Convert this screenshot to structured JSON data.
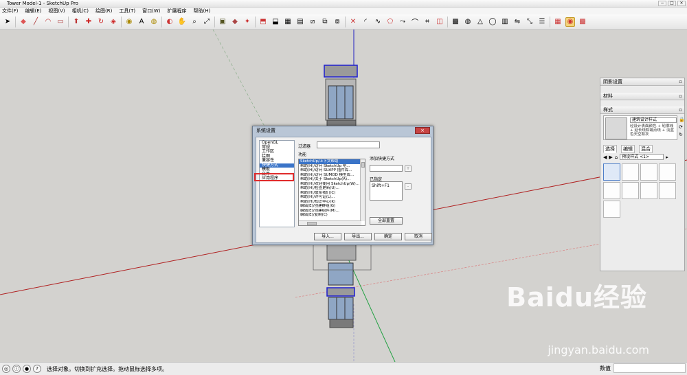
{
  "window": {
    "title": "Tower Model-1 - SketchUp Pro",
    "min": "−",
    "max": "□",
    "close": "×"
  },
  "menu": [
    "文件(F)",
    "编辑(E)",
    "视图(V)",
    "相机(C)",
    "绘图(R)",
    "工具(T)",
    "窗口(W)",
    "扩展程序",
    "帮助(H)"
  ],
  "toolbar_icons": [
    "select-icon",
    "eraser-icon",
    "pencil-icon",
    "arc-icon",
    "rectangle-icon",
    "push-pull-icon",
    "move-icon",
    "rotate-icon",
    "follow-me-icon",
    "tape-measure-icon",
    "text-icon",
    "paint-bucket-icon",
    "orbit-icon",
    "pan-icon",
    "zoom-icon",
    "zoom-extents-icon",
    "warehouse-icon",
    "component-icon",
    "extension-icon"
  ],
  "dialog": {
    "title": "系统设置",
    "close": "×",
    "categories": [
      "OpenGL",
      "常规",
      "工作区",
      "绘图",
      "兼容性",
      "快捷方式",
      "模板",
      "文件",
      "应用程序"
    ],
    "selected_category": "快捷方式",
    "filter_label": "过滤器",
    "function_label": "功能",
    "functions": [
      "SketchUp/上下文帮助",
      "帮助(H)/访问 SketchUp 吧...",
      "帮助(H)/访问 SUAPP 插件库...",
      "帮助(H)/访问 SUMOD 模型库...",
      "帮助(H)/关于 SketchUp(A)...",
      "帮助(H)/欢迎使用 SketchUp(W)...",
      "帮助(H)/检查更新(U)...",
      "帮助(H)/联系我们(C)",
      "帮助(H)/许可证(L)...",
      "帮助(H)/知识中心(K)",
      "编辑(E)/创建群组(G)",
      "编辑(E)/创建组件(M)...",
      "编辑(E)/复制(C)"
    ],
    "add_shortcut_label": "添加快捷方式",
    "plus": "+",
    "assigned_label": "已指定",
    "assigned_value": "Shift+F1",
    "minus": "-",
    "reset_all": "全部重置",
    "import": "导入...",
    "export": "导出...",
    "ok": "确定",
    "cancel": "取消"
  },
  "right_panel": {
    "shadow_settings": "阴影设置",
    "materials": "材料",
    "styles": "样式",
    "style_name": "建筑设计样式",
    "style_desc": "经设计表面颜色 + 轮廓线 + 延长线和端点线 + 淡蓝色天空和灰",
    "tabs": [
      "选择",
      "编辑",
      "混合"
    ],
    "preset": "预设样式 <1>"
  },
  "status": {
    "text": "选择对象。切换到扩充选择。拖动鼠标选择多项。",
    "value_label": "数值"
  },
  "watermark": {
    "brand": "Baidu经验",
    "url": "jingyan.baidu.com"
  }
}
